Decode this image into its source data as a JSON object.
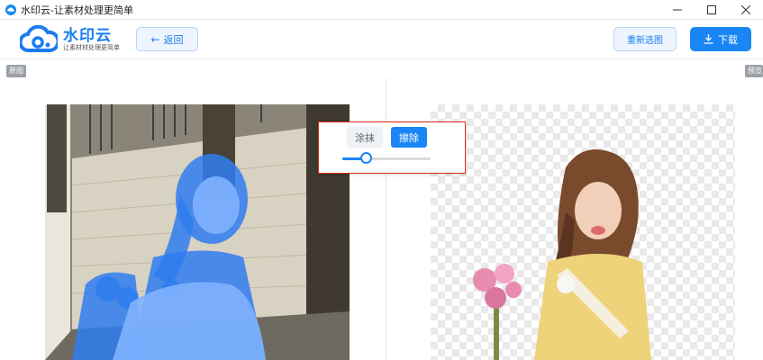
{
  "window": {
    "title": "水印云-让素材处理更简单",
    "controls": [
      "minimize",
      "maximize",
      "close"
    ]
  },
  "header": {
    "logo_name": "水印云",
    "logo_slogan": "让素材材处理更简单",
    "back_label": "返回",
    "reselect_label": "重新选图",
    "download_label": "下载"
  },
  "panels": {
    "left_tag": "原图",
    "right_tag": "预览"
  },
  "tools": {
    "paint_label": "涂抹",
    "erase_label": "擦除",
    "active_tool": "擦除",
    "brush_size_fraction": 0.27
  },
  "colors": {
    "accent": "#1a86f5",
    "highlight_border": "#e0281e",
    "mask_overlay": "#2f7cf0"
  }
}
